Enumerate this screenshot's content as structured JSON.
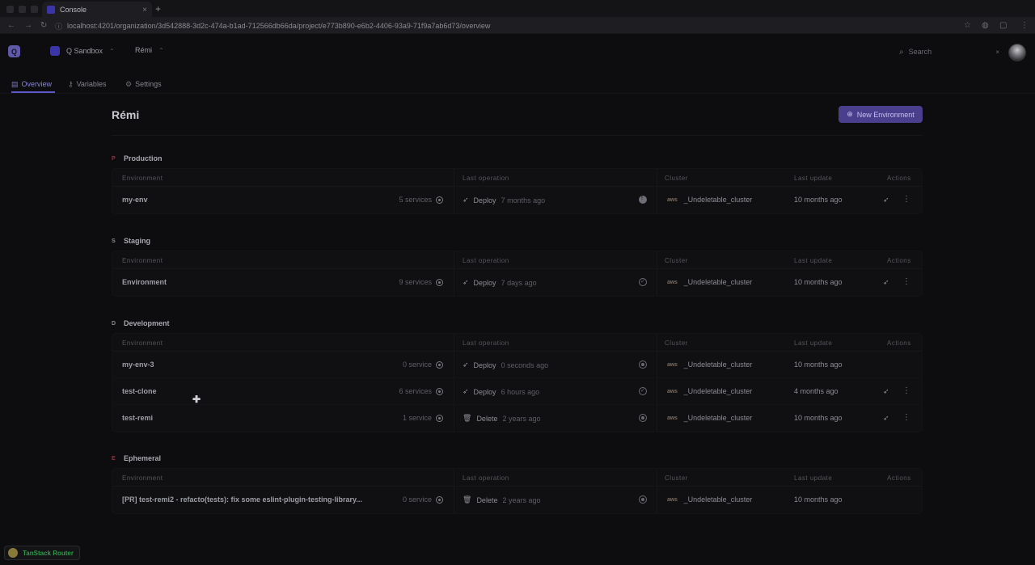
{
  "browser": {
    "tab_title": "Console",
    "tab_close": "×",
    "new_tab": "+",
    "url": "localhost:4201/organization/3d542888-3d2c-474a-b1ad-712566db66da/project/e773b890-e6b2-4406-93a9-71f9a7ab6d73/overview"
  },
  "header": {
    "logo_glyph": "Q",
    "organization": "Q Sandbox",
    "project": "Rémi",
    "search_placeholder": "Search",
    "search_clear": "×"
  },
  "subnav": {
    "items": [
      {
        "label": "Overview",
        "icon": "layout-icon",
        "active": true
      },
      {
        "label": "Variables",
        "icon": "key-icon",
        "active": false
      },
      {
        "label": "Settings",
        "icon": "gear-icon",
        "active": false
      }
    ]
  },
  "page": {
    "title": "Rémi",
    "new_environment_label": "New Environment"
  },
  "columns": {
    "environment": "Environment",
    "last_operation": "Last operation",
    "cluster": "Cluster",
    "last_update": "Last update",
    "actions": "Actions"
  },
  "aws_label": "aws",
  "sections": [
    {
      "letter": "P",
      "name": "Production",
      "letter_color": "#9a3040",
      "rows": [
        {
          "name": "my-env",
          "services": "5 services",
          "op": "Deploy",
          "op_icon": "rocket-icon",
          "time": "7 months ago",
          "status": "filled",
          "cluster": "_Undeletable_cluster",
          "updated": "10 months ago",
          "actions": true
        }
      ]
    },
    {
      "letter": "S",
      "name": "Staging",
      "letter_color": "#8a8a92",
      "rows": [
        {
          "name": "Environment",
          "services": "9 services",
          "op": "Deploy",
          "op_icon": "rocket-icon",
          "time": "7 days ago",
          "status": "check",
          "cluster": "_Undeletable_cluster",
          "updated": "10 months ago",
          "actions": true
        }
      ]
    },
    {
      "letter": "D",
      "name": "Development",
      "letter_color": "#8a8a92",
      "rows": [
        {
          "name": "my-env-3",
          "services": "0 service",
          "op": "Deploy",
          "op_icon": "rocket-icon",
          "time": "0 seconds ago",
          "status": "ring",
          "cluster": "_Undeletable_cluster",
          "updated": "10 months ago",
          "actions": false
        },
        {
          "name": "test-clone",
          "services": "6 services",
          "op": "Deploy",
          "op_icon": "rocket-icon",
          "time": "6 hours ago",
          "status": "check",
          "cluster": "_Undeletable_cluster",
          "updated": "4 months ago",
          "actions": true
        },
        {
          "name": "test-remi",
          "services": "1 service",
          "op": "Delete",
          "op_icon": "trash-icon",
          "time": "2 years ago",
          "status": "ring",
          "cluster": "_Undeletable_cluster",
          "updated": "10 months ago",
          "actions": true
        }
      ]
    },
    {
      "letter": "E",
      "name": "Ephemeral",
      "letter_color": "#9a3040",
      "rows": [
        {
          "name": "[PR] test-remi2 - refacto(tests): fix some eslint-plugin-testing-library...",
          "services": "0 service",
          "op": "Delete",
          "op_icon": "trash-icon",
          "time": "2 years ago",
          "status": "ring",
          "cluster": "_Undeletable_cluster",
          "updated": "10 months ago",
          "actions": false
        }
      ]
    }
  ],
  "devtools": {
    "label": "TanStack Router"
  },
  "colors": {
    "accent": "#5d58c8",
    "button_bg": "#4a3f8c"
  }
}
